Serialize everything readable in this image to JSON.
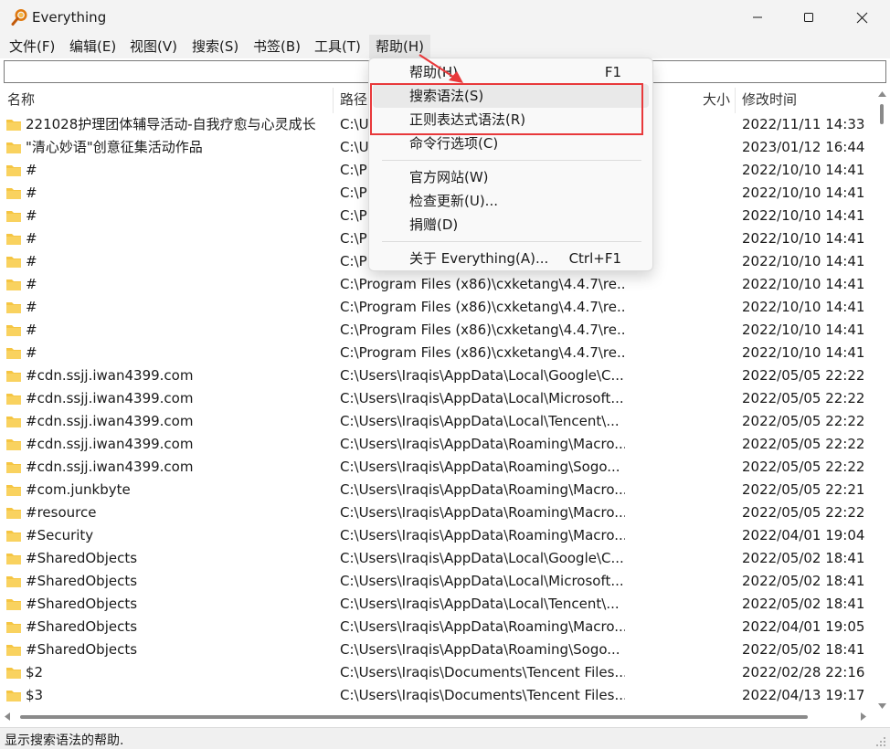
{
  "window": {
    "title": "Everything"
  },
  "menubar": {
    "items": [
      "文件(F)",
      "编辑(E)",
      "视图(V)",
      "搜索(S)",
      "书签(B)",
      "工具(T)",
      "帮助(H)"
    ]
  },
  "search": {
    "value": "",
    "placeholder": ""
  },
  "columns": {
    "name": "名称",
    "path": "路径",
    "size": "大小",
    "modified": "修改时间"
  },
  "rows": [
    {
      "name": "221028护理团体辅导活动-自我疗愈与心灵成长",
      "path": "C:\\U",
      "date": "2022/11/11 14:33"
    },
    {
      "name": "\"清心妙语\"创意征集活动作品",
      "path": "C:\\U",
      "date": "2023/01/12 16:44"
    },
    {
      "name": "#",
      "path": "C:\\P",
      "date": "2022/10/10 14:41"
    },
    {
      "name": "#",
      "path": "C:\\P",
      "date": "2022/10/10 14:41"
    },
    {
      "name": "#",
      "path": "C:\\P",
      "date": "2022/10/10 14:41"
    },
    {
      "name": "#",
      "path": "C:\\P",
      "date": "2022/10/10 14:41"
    },
    {
      "name": "#",
      "path": "C:\\P",
      "date": "2022/10/10 14:41"
    },
    {
      "name": "#",
      "path": "C:\\Program Files (x86)\\cxketang\\4.4.7\\re...",
      "date": "2022/10/10 14:41"
    },
    {
      "name": "#",
      "path": "C:\\Program Files (x86)\\cxketang\\4.4.7\\re...",
      "date": "2022/10/10 14:41"
    },
    {
      "name": "#",
      "path": "C:\\Program Files (x86)\\cxketang\\4.4.7\\re...",
      "date": "2022/10/10 14:41"
    },
    {
      "name": "#",
      "path": "C:\\Program Files (x86)\\cxketang\\4.4.7\\re...",
      "date": "2022/10/10 14:41"
    },
    {
      "name": "#cdn.ssjj.iwan4399.com",
      "path": "C:\\Users\\Iraqis\\AppData\\Local\\Google\\C...",
      "date": "2022/05/05 22:22"
    },
    {
      "name": "#cdn.ssjj.iwan4399.com",
      "path": "C:\\Users\\Iraqis\\AppData\\Local\\Microsoft...",
      "date": "2022/05/05 22:22"
    },
    {
      "name": "#cdn.ssjj.iwan4399.com",
      "path": "C:\\Users\\Iraqis\\AppData\\Local\\Tencent\\...",
      "date": "2022/05/05 22:22"
    },
    {
      "name": "#cdn.ssjj.iwan4399.com",
      "path": "C:\\Users\\Iraqis\\AppData\\Roaming\\Macro...",
      "date": "2022/05/05 22:22"
    },
    {
      "name": "#cdn.ssjj.iwan4399.com",
      "path": "C:\\Users\\Iraqis\\AppData\\Roaming\\Sogo...",
      "date": "2022/05/05 22:22"
    },
    {
      "name": "#com.junkbyte",
      "path": "C:\\Users\\Iraqis\\AppData\\Roaming\\Macro...",
      "date": "2022/05/05 22:21"
    },
    {
      "name": "#resource",
      "path": "C:\\Users\\Iraqis\\AppData\\Roaming\\Macro...",
      "date": "2022/05/05 22:22"
    },
    {
      "name": "#Security",
      "path": "C:\\Users\\Iraqis\\AppData\\Roaming\\Macro...",
      "date": "2022/04/01 19:04"
    },
    {
      "name": "#SharedObjects",
      "path": "C:\\Users\\Iraqis\\AppData\\Local\\Google\\C...",
      "date": "2022/05/02 18:41"
    },
    {
      "name": "#SharedObjects",
      "path": "C:\\Users\\Iraqis\\AppData\\Local\\Microsoft...",
      "date": "2022/05/02 18:41"
    },
    {
      "name": "#SharedObjects",
      "path": "C:\\Users\\Iraqis\\AppData\\Local\\Tencent\\...",
      "date": "2022/05/02 18:41"
    },
    {
      "name": "#SharedObjects",
      "path": "C:\\Users\\Iraqis\\AppData\\Roaming\\Macro...",
      "date": "2022/04/01 19:05"
    },
    {
      "name": "#SharedObjects",
      "path": "C:\\Users\\Iraqis\\AppData\\Roaming\\Sogo...",
      "date": "2022/05/02 18:41"
    },
    {
      "name": "$2",
      "path": "C:\\Users\\Iraqis\\Documents\\Tencent Files...",
      "date": "2022/02/28 22:16"
    },
    {
      "name": "$3",
      "path": "C:\\Users\\Iraqis\\Documents\\Tencent Files...",
      "date": "2022/04/13 19:17"
    }
  ],
  "help_menu": {
    "items": [
      {
        "label": "帮助(H)",
        "shortcut": "F1"
      },
      {
        "label": "搜索语法(S)",
        "shortcut": ""
      },
      {
        "label": "正则表达式语法(R)",
        "shortcut": ""
      },
      {
        "label": "命令行选项(C)",
        "shortcut": ""
      },
      {
        "label": "官方网站(W)",
        "shortcut": ""
      },
      {
        "label": "检查更新(U)...",
        "shortcut": ""
      },
      {
        "label": "捐赠(D)",
        "shortcut": ""
      },
      {
        "label": "关于 Everything(A)...",
        "shortcut": "Ctrl+F1"
      }
    ]
  },
  "status": {
    "text": "显示搜索语法的帮助."
  },
  "colors": {
    "annotation": "#e8393b",
    "folder": "#f5c542",
    "menu_highlight": "#e9e9e9"
  }
}
